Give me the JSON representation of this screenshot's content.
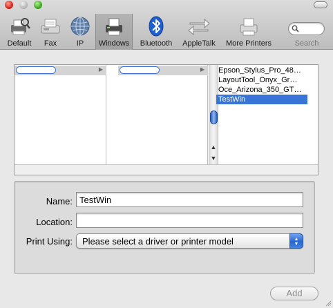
{
  "toolbar": {
    "items": [
      {
        "label": "Default",
        "icon": "default-printer-icon",
        "selected": false
      },
      {
        "label": "Fax",
        "icon": "fax-icon",
        "selected": false
      },
      {
        "label": "IP",
        "icon": "ip-globe-icon",
        "selected": false
      },
      {
        "label": "Windows",
        "icon": "windows-printer-icon",
        "selected": true
      },
      {
        "label": "Bluetooth",
        "icon": "bluetooth-icon",
        "selected": false
      },
      {
        "label": "AppleTalk",
        "icon": "appletalk-arrows-icon",
        "selected": false
      },
      {
        "label": "More Printers",
        "icon": "more-printers-icon",
        "selected": false
      }
    ],
    "search": {
      "label": "Search",
      "value": ""
    }
  },
  "browser": {
    "printers": [
      "Epson_Stylus_Pro_48…",
      "LayoutTool_Onyx_Gr…",
      "Oce_Arizona_350_GT…",
      "TestWin"
    ],
    "selected_printer": "TestWin"
  },
  "form": {
    "name_label": "Name:",
    "name_value": "TestWin",
    "location_label": "Location:",
    "location_value": "",
    "print_using_label": "Print Using:",
    "print_using_value": "Please select a driver or printer model"
  },
  "actions": {
    "add_label": "Add"
  },
  "colors": {
    "selection": "#3875d7",
    "accent": "#2a66cf"
  }
}
